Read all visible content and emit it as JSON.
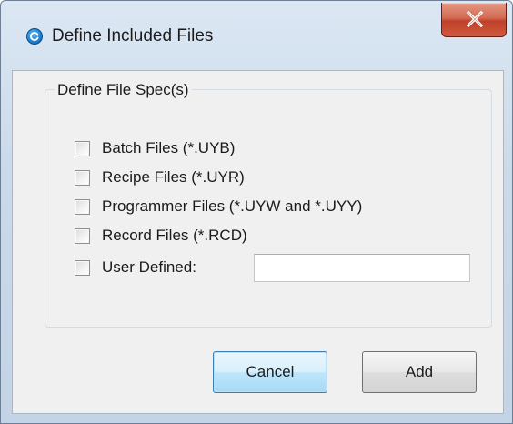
{
  "window": {
    "title": "Define Included Files",
    "icon": "app-refresh-icon",
    "close_icon": "close-icon"
  },
  "group": {
    "title": "Define File Spec(s)",
    "options": [
      {
        "label": "Batch Files (*.UYB)",
        "checked": false
      },
      {
        "label": "Recipe Files (*.UYR)",
        "checked": false
      },
      {
        "label": "Programmer Files (*.UYW and *.UYY)",
        "checked": false
      },
      {
        "label": "Record Files (*.RCD)",
        "checked": false
      },
      {
        "label": "User Defined:",
        "checked": false
      }
    ],
    "user_defined_value": ""
  },
  "buttons": {
    "cancel_label": "Cancel",
    "add_label": "Add"
  },
  "colors": {
    "title_bar": "#cbdaea",
    "close_button": "#c0402a",
    "default_button": "#bee6fd"
  }
}
